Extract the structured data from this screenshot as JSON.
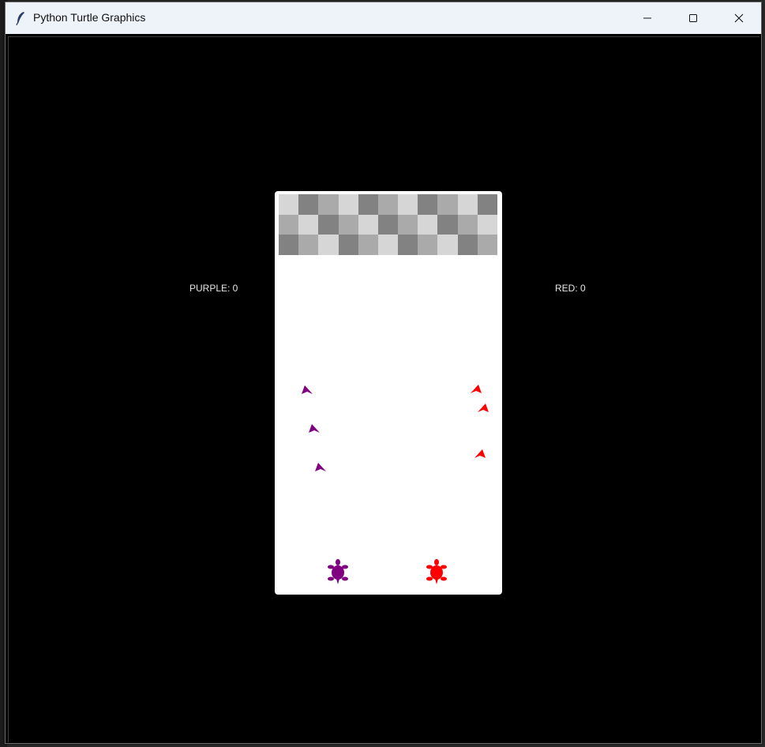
{
  "window": {
    "title": "Python Turtle Graphics",
    "icon": "feather-icon",
    "controls": [
      "minimize-icon",
      "maximize-icon",
      "close-icon"
    ]
  },
  "scoreboard": {
    "purple_text": "PURPLE: 0",
    "red_text": "RED: 0"
  },
  "finish_line": {
    "rows": [
      [
        "light",
        "dark",
        "mid",
        "light",
        "dark",
        "mid",
        "light",
        "dark",
        "mid",
        "light",
        "dark"
      ],
      [
        "mid",
        "light",
        "dark",
        "mid",
        "light",
        "dark",
        "mid",
        "light",
        "dark",
        "mid",
        "light"
      ],
      [
        "dark",
        "mid",
        "light",
        "dark",
        "mid",
        "light",
        "dark",
        "mid",
        "light",
        "dark",
        "mid"
      ]
    ],
    "shades": {
      "light": "#d6d6d6",
      "mid": "#aaaaaa",
      "dark": "#828282"
    }
  },
  "colors": {
    "purple": "#800080",
    "red": "#ff0000",
    "board": "#ffffff",
    "background": "#000000"
  },
  "players": [
    {
      "color": "purple",
      "shape": "turtle-icon"
    },
    {
      "color": "red",
      "shape": "turtle-icon"
    }
  ],
  "obstacles": [
    {
      "color": "purple",
      "shape": "arrow-icon"
    },
    {
      "color": "purple",
      "shape": "arrow-icon"
    },
    {
      "color": "purple",
      "shape": "arrow-icon"
    },
    {
      "color": "red",
      "shape": "arrow-icon"
    },
    {
      "color": "red",
      "shape": "arrow-icon"
    },
    {
      "color": "red",
      "shape": "arrow-icon"
    }
  ]
}
